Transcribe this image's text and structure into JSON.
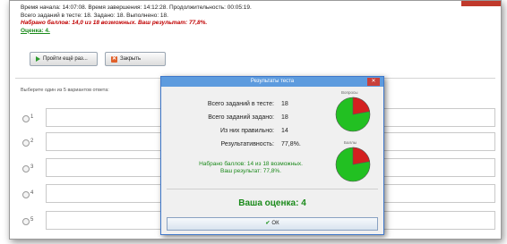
{
  "info": {
    "line1": "Время начала: 14:07:08. Время завершения: 14:12:28. Продолжительность: 00:05:19.",
    "line2": "Всего заданий в тесте: 18. Задано: 18. Выполнено: 18.",
    "line3": "Набрано баллов: 14,0 из 18 возможных. Ваш результат: 77,8%.",
    "line4": "Оценка: 4."
  },
  "buttons": {
    "retry_label": "Пройти ещё раз...",
    "close_label": "Закрыть"
  },
  "question": {
    "prompt": "Выберите один из 5 вариантов ответа:",
    "options": [
      {
        "num": "1"
      },
      {
        "num": "2"
      },
      {
        "num": "3"
      },
      {
        "num": "4"
      },
      {
        "num": "5"
      }
    ]
  },
  "dialog": {
    "title": "Результаты теста",
    "close_glyph": "✕",
    "stats": [
      {
        "label": "Всего заданий в тесте:",
        "value": "18"
      },
      {
        "label": "Всего заданий задано:",
        "value": "18"
      },
      {
        "label": "Из них правильно:",
        "value": "14"
      },
      {
        "label": "Результативность:",
        "value": "77,8%."
      }
    ],
    "pie1_caption": "Вопросы",
    "pie2_caption": "Баллы",
    "pie_fraction_correct": 0.778,
    "result_line1": "Набрано баллов: 14 из 18 возможных.",
    "result_line2": "Ваш результат: 77,8%.",
    "final_grade": "Ваша оценка: 4",
    "ok_label": "ОК"
  },
  "colors": {
    "correct": "#22c022",
    "wrong": "#d42020",
    "accent": "#5d9bde"
  }
}
